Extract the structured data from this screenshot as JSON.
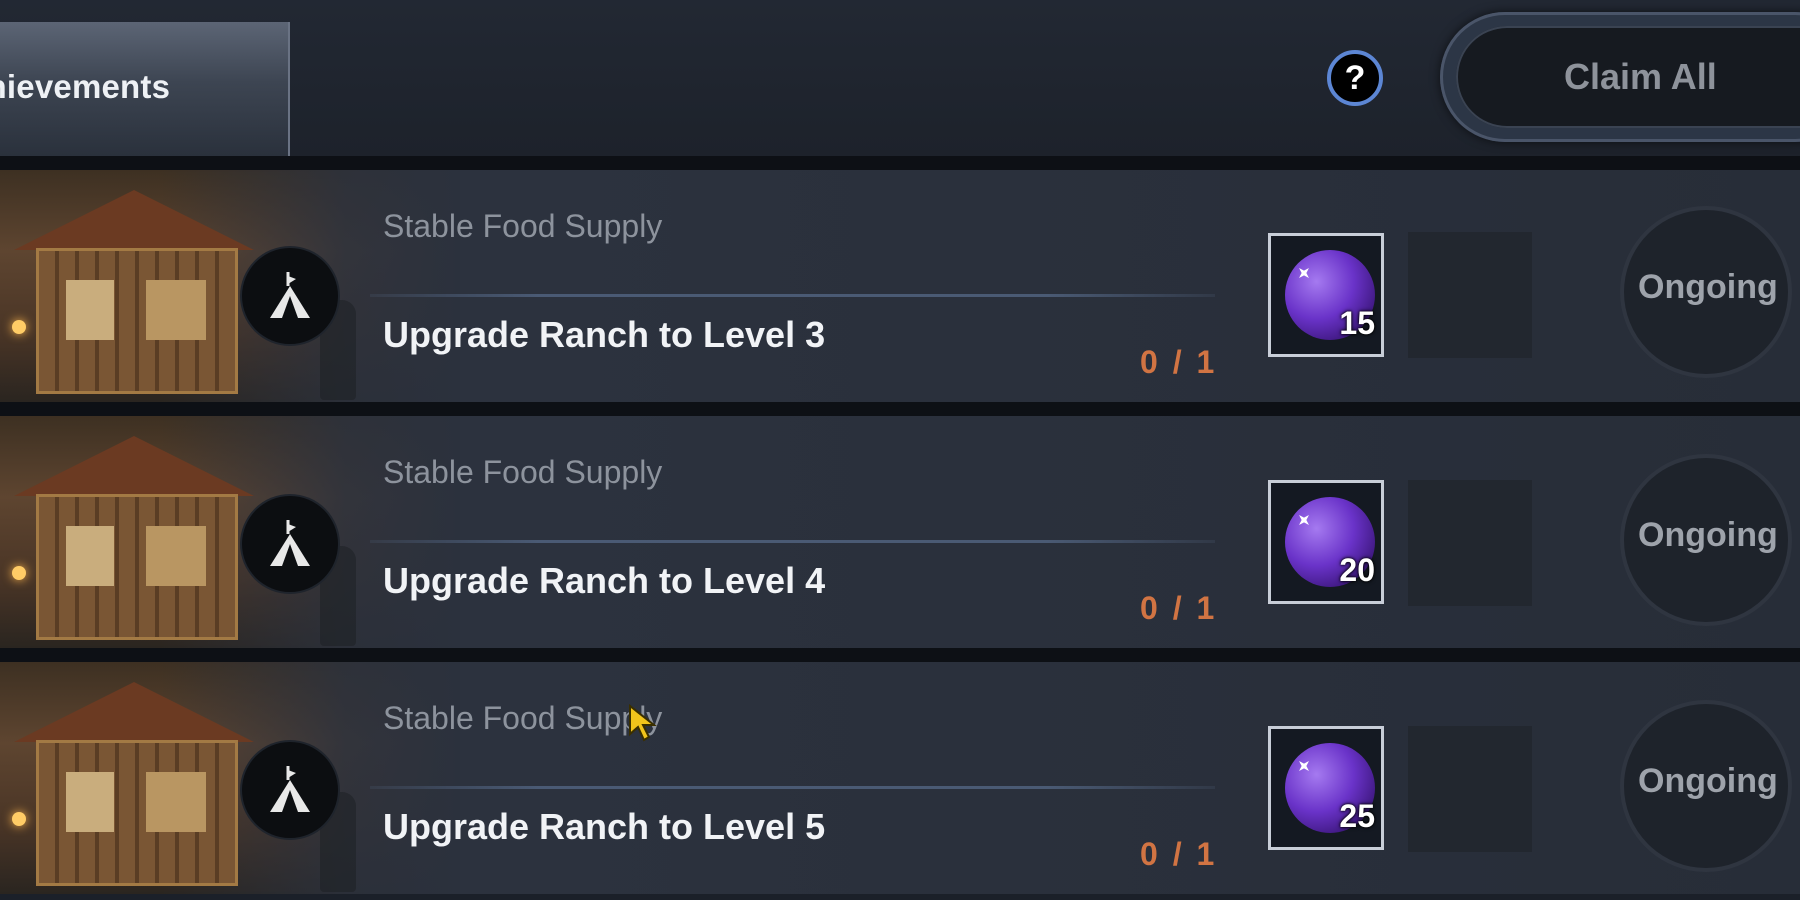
{
  "header": {
    "tab_label": "chievements",
    "help_label": "?",
    "claim_all_label": "Claim All"
  },
  "achievements": [
    {
      "category": "Stable Food Supply",
      "title": "Upgrade Ranch to Level 3",
      "progress": "0 / 1",
      "reward_qty": "15",
      "status": "Ongoing"
    },
    {
      "category": "Stable Food Supply",
      "title": "Upgrade Ranch to Level 4",
      "progress": "0 / 1",
      "reward_qty": "20",
      "status": "Ongoing"
    },
    {
      "category": "Stable Food Supply",
      "title": "Upgrade Ranch to Level 5",
      "progress": "0 / 1",
      "reward_qty": "25",
      "status": "Ongoing"
    }
  ],
  "icons": {
    "help": "question-mark-icon",
    "row": "tent-icon",
    "reward": "purple-orb-icon"
  },
  "colors": {
    "progress": "#d17443",
    "help_ring": "#5c86d4",
    "reward_orb": "#6a33c9"
  }
}
